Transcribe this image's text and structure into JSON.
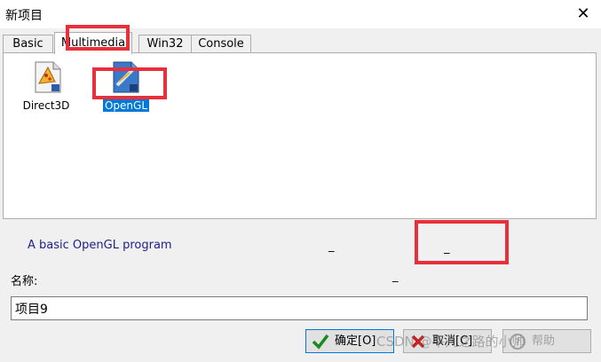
{
  "window": {
    "title": "新项目",
    "close_icon": "close-icon"
  },
  "tabs": [
    {
      "label": "Basic",
      "active": false
    },
    {
      "label": "Multimedia",
      "active": true
    },
    {
      "label": "Win32",
      "active": false
    },
    {
      "label": "Console",
      "active": false
    }
  ],
  "templates": [
    {
      "label": "Direct3D",
      "icon": "direct3d-template-icon",
      "selected": false
    },
    {
      "label": "OpenGL",
      "icon": "opengl-template-icon",
      "selected": true
    }
  ],
  "description": "A basic OpenGL program",
  "placeholders": {
    "dash1": "_",
    "dash2": "_",
    "dash3": "_"
  },
  "name_field": {
    "label": "名称:",
    "value": "项目9"
  },
  "buttons": {
    "ok": "确定[O]",
    "cancel": "取消[C]",
    "help": "帮助"
  },
  "watermark": "CSDN @平凡之路的小帅",
  "colors": {
    "highlight": "#e8303a",
    "selection": "#0078d7",
    "description_text": "#1e1e88"
  }
}
